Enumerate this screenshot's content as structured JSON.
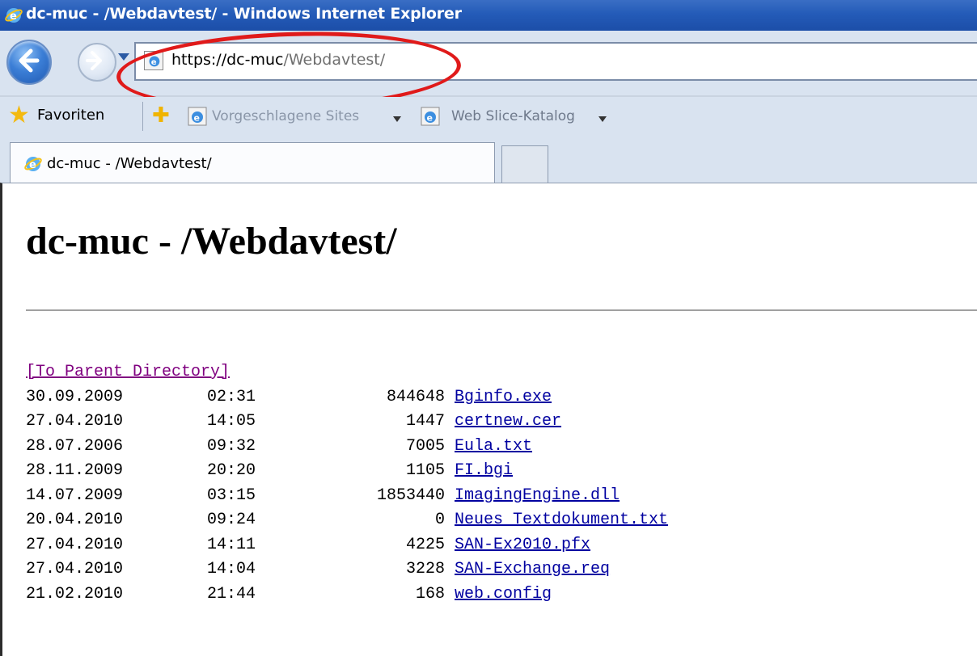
{
  "window": {
    "title": "dc-muc - /Webdavtest/ - Windows Internet Explorer"
  },
  "address": {
    "scheme_host": "https://dc-muc",
    "path": "/Webdavtest/"
  },
  "annotation": {
    "color": "#e01a1a"
  },
  "favorites_bar": {
    "favorites_label": "Favoriten",
    "suggested_label": "Vorgeschlagene Sites",
    "webslice_label": "Web Slice-Katalog"
  },
  "tab": {
    "label": "dc-muc - /Webdavtest/"
  },
  "page": {
    "heading": "dc-muc - /Webdavtest/",
    "parent_link": "[To Parent Directory]",
    "files": [
      {
        "date": "30.09.2009",
        "time": "02:31",
        "size": "844648",
        "name": "Bginfo.exe"
      },
      {
        "date": "27.04.2010",
        "time": "14:05",
        "size": "1447",
        "name": "certnew.cer"
      },
      {
        "date": "28.07.2006",
        "time": "09:32",
        "size": "7005",
        "name": "Eula.txt"
      },
      {
        "date": "28.11.2009",
        "time": "20:20",
        "size": "1105",
        "name": "FI.bgi"
      },
      {
        "date": "14.07.2009",
        "time": "03:15",
        "size": "1853440",
        "name": "ImagingEngine.dll"
      },
      {
        "date": "20.04.2010",
        "time": "09:24",
        "size": "0",
        "name": "Neues Textdokument.txt"
      },
      {
        "date": "27.04.2010",
        "time": "14:11",
        "size": "4225",
        "name": "SAN-Ex2010.pfx"
      },
      {
        "date": "27.04.2010",
        "time": "14:04",
        "size": "3228",
        "name": "SAN-Exchange.req"
      },
      {
        "date": "21.02.2010",
        "time": "21:44",
        "size": "168",
        "name": "web.config"
      }
    ]
  },
  "colors": {
    "titlebar": "#245bb8",
    "link_visited": "#800080",
    "link": "#0000a0"
  },
  "icons": {
    "title": "ie-logo-icon",
    "back": "back-arrow-icon",
    "forward": "forward-arrow-icon",
    "favorites": "star-icon",
    "add_favorite": "add-favorite-icon",
    "page": "ie-page-icon"
  }
}
